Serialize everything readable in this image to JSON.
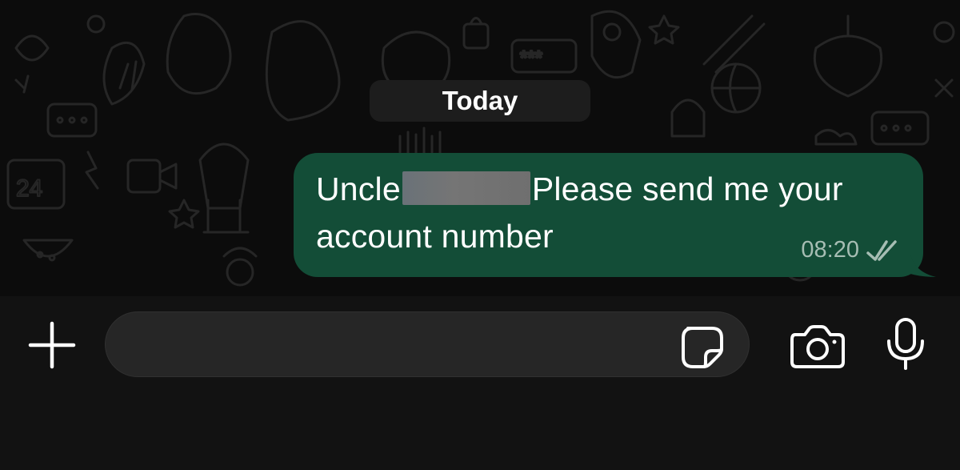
{
  "chat": {
    "date_separator": "Today",
    "messages": [
      {
        "direction": "outgoing",
        "text_before_redaction": "Uncle",
        "text_after_redaction": "Please send me your",
        "text_line2": "account number",
        "time": "08:20",
        "status": "read-double-check",
        "status_icon": "double-check-icon"
      }
    ]
  },
  "composer": {
    "value": "",
    "placeholder": "",
    "attach_icon": "plus-icon",
    "sticker_icon": "sticker-icon",
    "camera_icon": "camera-icon",
    "mic_icon": "microphone-icon"
  },
  "colors": {
    "chat_background": "#0c0c0c",
    "outgoing_bubble": "#134d37",
    "date_pill": "#1d1d1d",
    "input_bar": "#121212",
    "input_field": "#262626",
    "timestamp": "#a6bdb3",
    "icon": "#ffffff"
  }
}
